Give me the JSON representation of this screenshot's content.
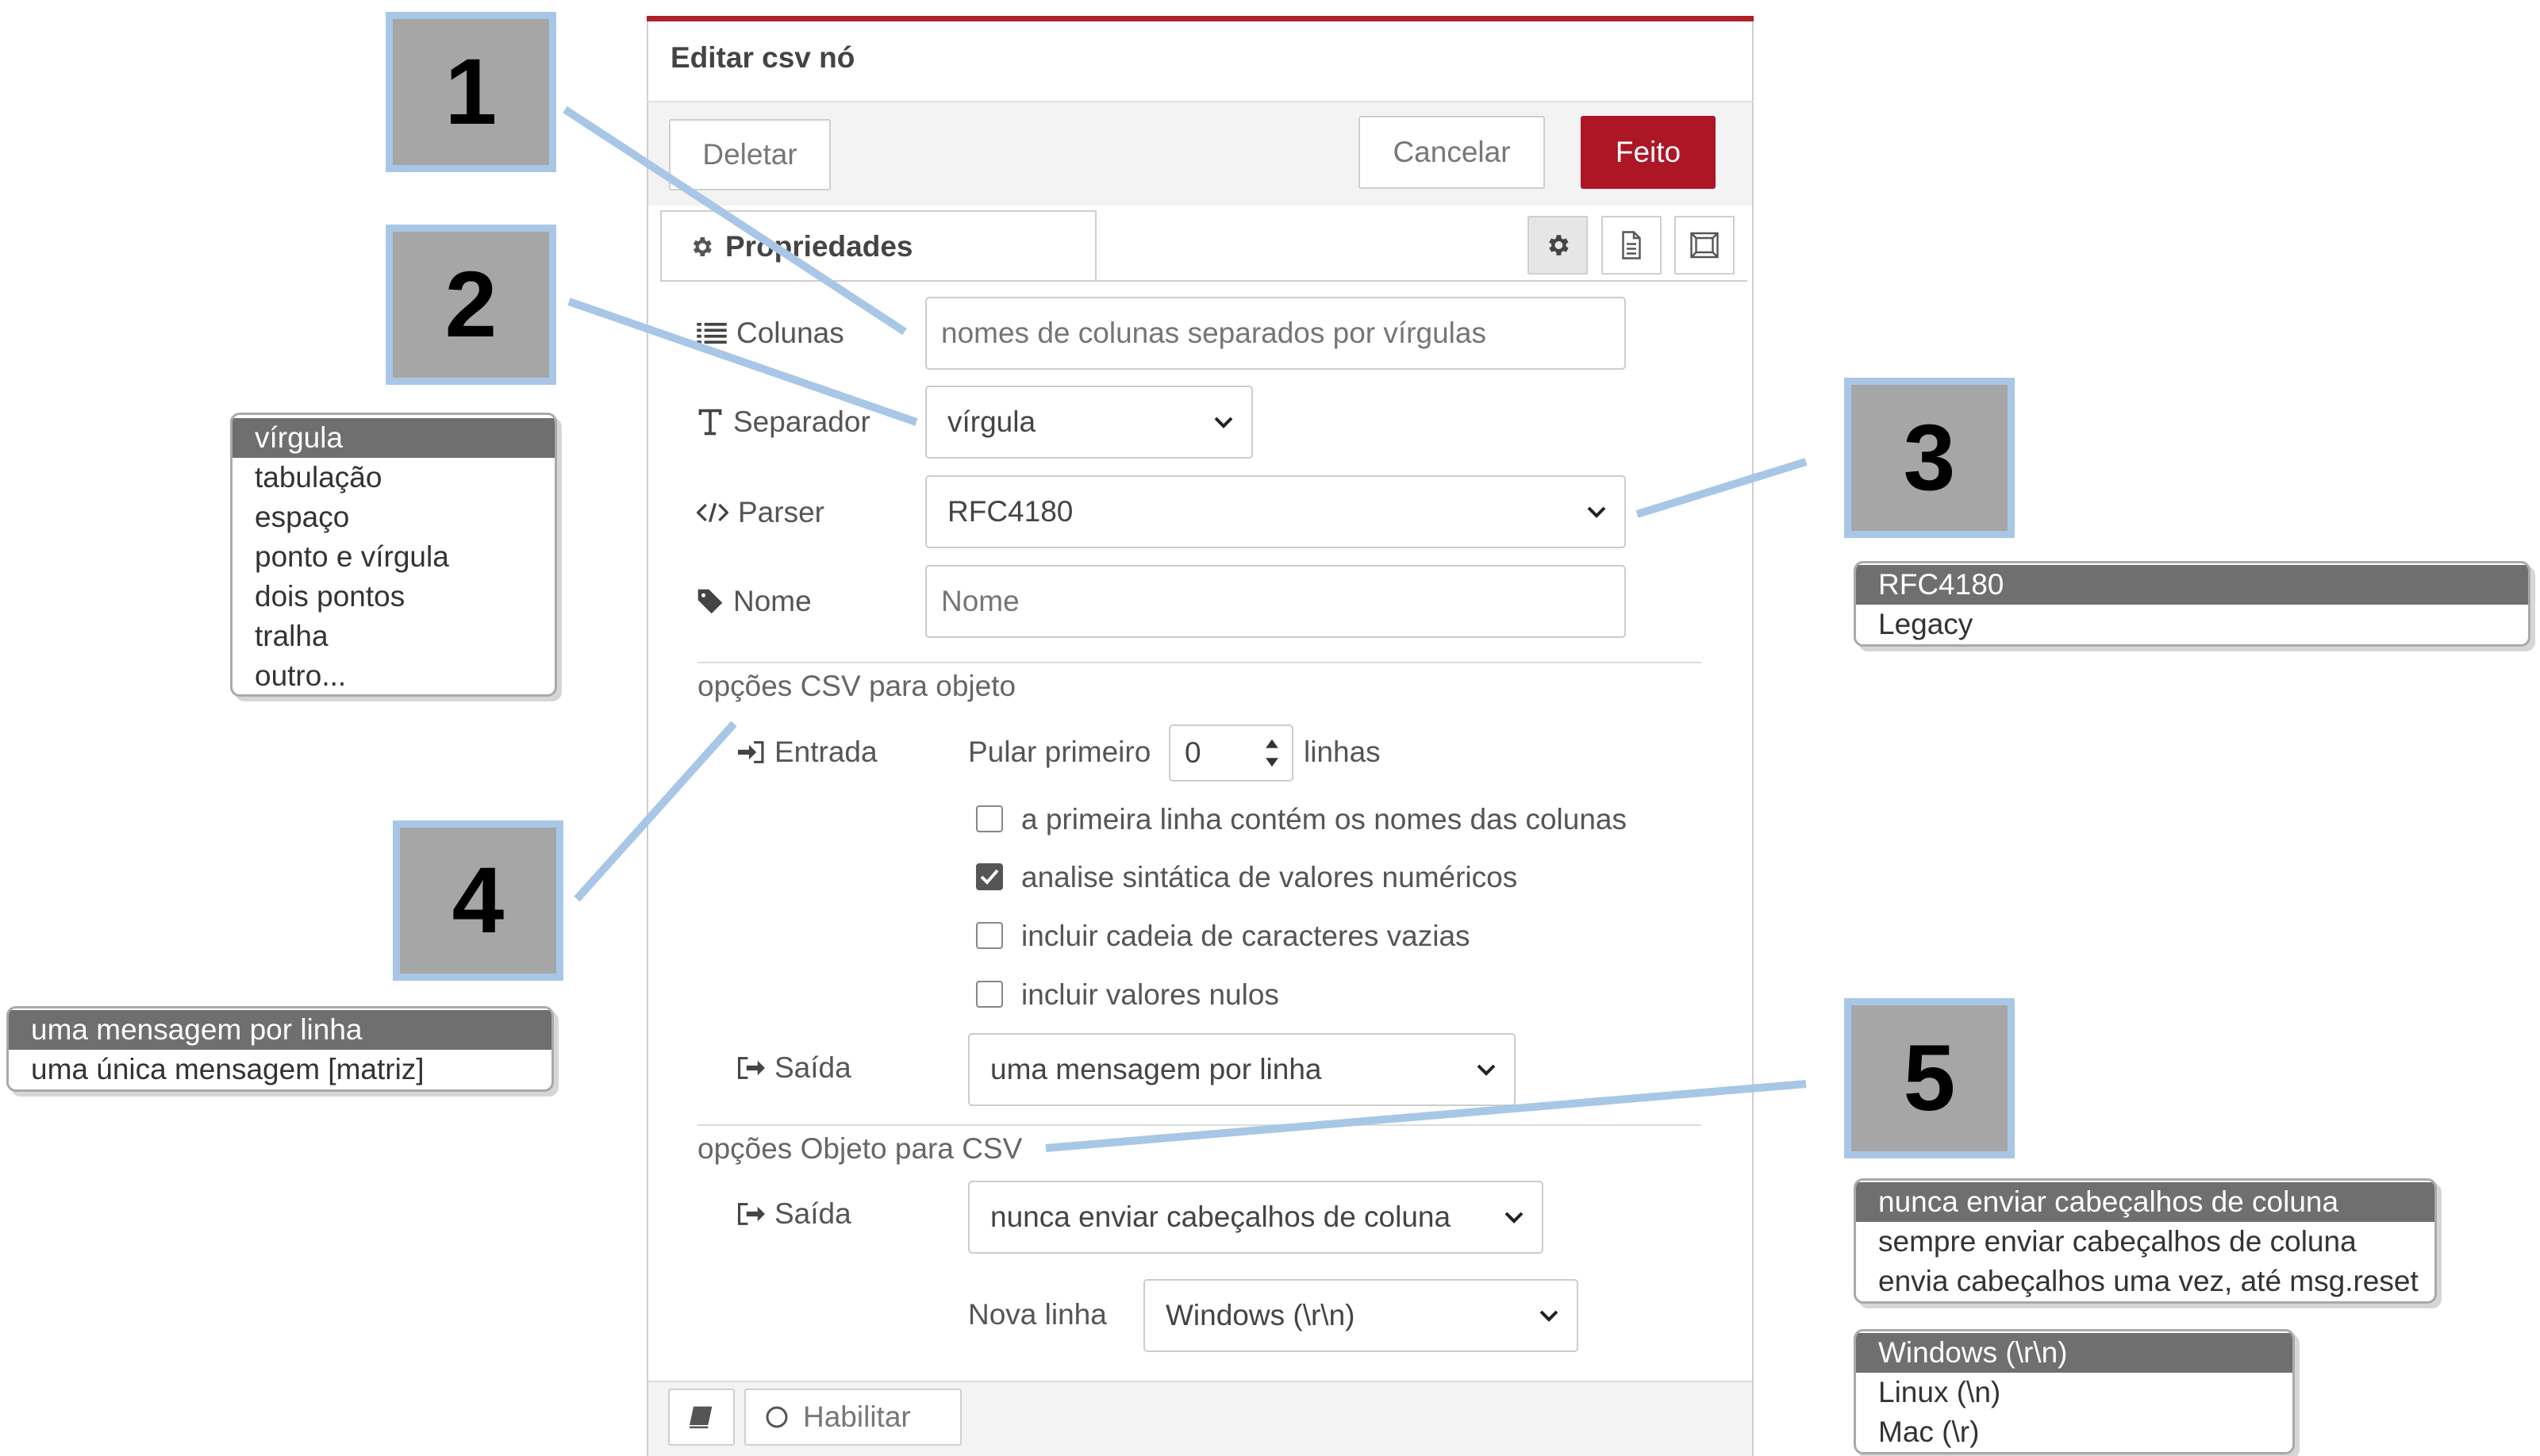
{
  "dialog": {
    "title": "Editar csv nó",
    "buttons": {
      "delete": "Deletar",
      "cancel": "Cancelar",
      "done": "Feito"
    },
    "tab": "Propriedades"
  },
  "form": {
    "columns": {
      "label": "Colunas",
      "placeholder": "nomes de colunas separados por vírgulas"
    },
    "separator": {
      "label": "Separador",
      "value": "vírgula"
    },
    "parser": {
      "label": "Parser",
      "value": "RFC4180"
    },
    "name": {
      "label": "Nome",
      "placeholder": "Nome"
    },
    "csv_to_object": {
      "title": "opções CSV para objeto",
      "input_label": "Entrada",
      "skip_label": "Pular primeiro",
      "skip_value": "0",
      "skip_unit": "linhas",
      "checkboxes": [
        {
          "label": "a primeira linha contém os nomes das colunas",
          "checked": false
        },
        {
          "label": "analise sintática de valores numéricos",
          "checked": true
        },
        {
          "label": "incluir cadeia de caracteres vazias",
          "checked": false
        },
        {
          "label": "incluir valores nulos",
          "checked": false
        }
      ],
      "output_label": "Saída",
      "output_value": "uma mensagem por linha"
    },
    "object_to_csv": {
      "title": "opções Objeto para CSV",
      "output_label": "Saída",
      "output_value": "nunca enviar cabeçalhos de coluna",
      "newline_label": "Nova linha",
      "newline_value": "Windows (\\r\\n)"
    }
  },
  "footer": {
    "enable": "Habilitar"
  },
  "callouts": [
    "1",
    "2",
    "3",
    "4",
    "5"
  ],
  "popups": {
    "separator_options": [
      "vírgula",
      "tabulação",
      "espaço",
      "ponto e vírgula",
      "dois pontos",
      "tralha",
      "outro..."
    ],
    "parser_options": [
      "RFC4180",
      "Legacy"
    ],
    "output_options": [
      "uma mensagem por linha",
      "uma única mensagem [matriz]"
    ],
    "header_options": [
      "nunca enviar cabeçalhos de coluna",
      "sempre enviar cabeçalhos de coluna",
      "envia cabeçalhos uma vez, até msg.reset"
    ],
    "newline_options": [
      "Windows (\\r\\n)",
      "Linux (\\n)",
      "Mac (\\r)"
    ]
  },
  "colors": {
    "accent": "#ad1625",
    "callout_fill": "#a6a6a6",
    "callout_border": "#a8c7e6",
    "leader_line": "#a8c7e6"
  }
}
